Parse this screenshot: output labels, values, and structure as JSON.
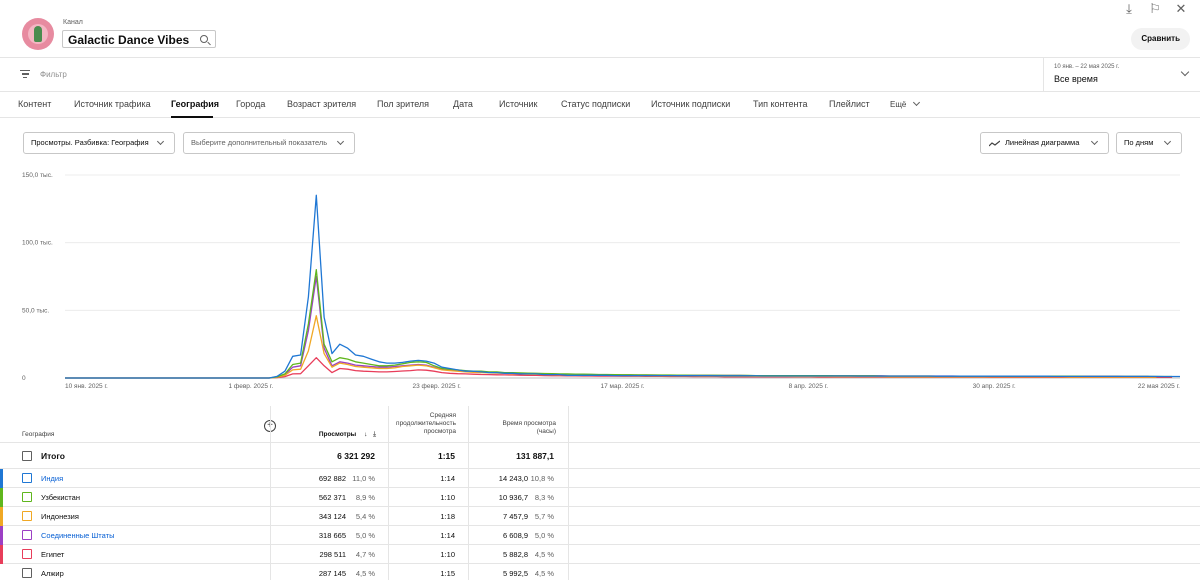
{
  "header": {
    "channel_label": "Канал",
    "channel_name": "Galactic Dance Vibes",
    "compare_label": "Сравнить",
    "icons": [
      "download-icon",
      "feedback-icon",
      "close-icon"
    ]
  },
  "filter": {
    "placeholder": "Фильтр",
    "date_range": "10 янв. – 22 мая 2025 г.",
    "date_value": "Все время"
  },
  "tabs": [
    {
      "label": "Контент"
    },
    {
      "label": "Источник трафика"
    },
    {
      "label": "География",
      "active": true
    },
    {
      "label": "Города"
    },
    {
      "label": "Возраст зрителя"
    },
    {
      "label": "Пол зрителя"
    },
    {
      "label": "Дата"
    },
    {
      "label": "Источник"
    },
    {
      "label": "Статус подписки"
    },
    {
      "label": "Источник подписки"
    },
    {
      "label": "Тип контента"
    },
    {
      "label": "Плейлист"
    },
    {
      "label": "Ещё"
    }
  ],
  "controls": {
    "metric": "Просмотры. Разбивка: География",
    "extra_metric": "Выберите дополнительный показатель",
    "chart_type": "Линейная диаграмма",
    "granularity": "По дням"
  },
  "chart_data": {
    "type": "line",
    "y_ticks": [
      "150,0 тыс.",
      "100,0 тыс.",
      "50,0 тыс.",
      "0"
    ],
    "ylim": [
      0,
      150000
    ],
    "x_ticks": [
      "10 янв. 2025 г.",
      "1 февр. 2025 г.",
      "23 февр. 2025 г.",
      "17 мар. 2025 г.",
      "8 апр. 2025 г.",
      "30 апр. 2025 г.",
      "22 мая 2025 г."
    ],
    "grid": true,
    "series": [
      {
        "name": "Индия",
        "color": "#1f77d4",
        "values": [
          0,
          0,
          0,
          0,
          0,
          0,
          0,
          0,
          0,
          0,
          0,
          0,
          0,
          0,
          0,
          0,
          0,
          0,
          0,
          0,
          0,
          0,
          0,
          0,
          0,
          0,
          0,
          1200,
          5000,
          16000,
          17000,
          60000,
          135000,
          45000,
          18000,
          25000,
          22000,
          17000,
          16000,
          14000,
          12000,
          11000,
          11000,
          11500,
          12500,
          13000,
          12500,
          11000,
          8000,
          7000,
          6000,
          5000,
          5000,
          4500,
          4000,
          4000,
          3500,
          3500,
          3000,
          3000,
          3000,
          2500,
          2500,
          2500,
          2000,
          2000,
          2000,
          2000,
          2000,
          2000,
          1800,
          1800,
          1800,
          1800,
          1800,
          1800,
          1800,
          1800,
          1700,
          1700,
          1700,
          1700,
          1700,
          1600,
          1600,
          1600,
          1600,
          1600,
          1600,
          1500,
          1500,
          1500,
          1500,
          1500,
          1500,
          1500,
          1500,
          1500,
          1500,
          1500,
          1500,
          1400,
          1400,
          1400,
          1400,
          1400,
          1400,
          1400,
          1400,
          1400,
          1400,
          1300,
          1300,
          1300,
          1300,
          1300,
          1300,
          1300,
          1300,
          1300,
          1300,
          1300,
          1300,
          1300,
          1300,
          1300,
          1200,
          1200,
          1200,
          1200,
          1200,
          1200,
          1200,
          1200,
          1200,
          1200,
          1200,
          1200,
          1200,
          1200,
          1100,
          1100,
          1100
        ]
      },
      {
        "name": "Узбекистан",
        "color": "#5fb61d",
        "values": [
          0,
          0,
          0,
          0,
          0,
          0,
          0,
          0,
          0,
          0,
          0,
          0,
          0,
          0,
          0,
          0,
          0,
          0,
          0,
          0,
          0,
          0,
          0,
          0,
          0,
          0,
          0,
          800,
          3000,
          10000,
          11000,
          40000,
          80000,
          25000,
          12000,
          15000,
          14000,
          12000,
          11000,
          10000,
          9000,
          9000,
          9500,
          10500,
          11500,
          12000,
          11500,
          9000,
          7000,
          6500,
          6000,
          5500,
          5000,
          5000,
          4500,
          4500,
          4000,
          4000,
          3800,
          3600,
          3500,
          3300,
          3200,
          3000,
          3000,
          2800,
          2800,
          2700,
          2600,
          2600,
          2500,
          2400,
          2400,
          2300,
          2300,
          2200,
          2200,
          2200,
          2100,
          2100,
          2000,
          2000,
          2000,
          2000,
          1900,
          1900,
          1900,
          1900,
          1800,
          1800,
          1800,
          1800,
          1800,
          1700,
          1700,
          1700,
          1700,
          1700,
          1600,
          1600,
          1600,
          1600,
          1600,
          1600,
          1500,
          1500,
          1500,
          1500,
          1500,
          1500,
          1500,
          1400,
          1400,
          1400,
          1400,
          1400,
          1400,
          1400,
          1400,
          1400,
          1300,
          1300,
          1300,
          1300,
          1300,
          1300,
          1300,
          1300,
          1300,
          1300,
          1200,
          1200,
          1200,
          1200,
          1200,
          1200,
          1200,
          1200,
          1200,
          1100,
          1100,
          1100
        ]
      },
      {
        "name": "Индонезия",
        "color": "#f0a824",
        "values": [
          0,
          0,
          0,
          0,
          0,
          0,
          0,
          0,
          0,
          0,
          0,
          0,
          0,
          0,
          0,
          0,
          0,
          0,
          0,
          0,
          0,
          0,
          0,
          0,
          0,
          0,
          0,
          500,
          2000,
          6000,
          6500,
          20000,
          46000,
          18000,
          8000,
          11000,
          10000,
          8500,
          8000,
          7500,
          7000,
          7000,
          7500,
          8500,
          9000,
          9500,
          9000,
          7500,
          6000,
          5500,
          5000,
          4500,
          4200,
          4000,
          3800,
          3600,
          3400,
          3200,
          3000,
          2800,
          2700,
          2600,
          2500,
          2400,
          2300,
          2200,
          2100,
          2000,
          2000,
          1900,
          1900,
          1800,
          1800,
          1700,
          1700,
          1600,
          1600,
          1600,
          1500,
          1500,
          1500,
          1400,
          1400,
          1400,
          1300,
          1300,
          1300,
          1300,
          1200,
          1200,
          1200,
          1200,
          1200,
          1100,
          1100,
          1100,
          1100,
          1100,
          1000,
          1000,
          1000,
          1000,
          1000,
          1000,
          1000,
          900,
          900,
          900,
          900,
          900,
          900,
          900,
          900,
          900,
          900,
          800,
          800,
          800,
          800,
          800,
          800,
          800,
          800,
          800,
          800,
          800,
          800,
          800,
          700,
          700,
          700,
          700,
          700,
          700,
          700,
          700,
          700,
          700,
          700,
          700
        ]
      },
      {
        "name": "Соединенные Штаты",
        "color": "#9c3fc4",
        "values": [
          0,
          0,
          0,
          0,
          0,
          0,
          0,
          0,
          0,
          0,
          0,
          0,
          0,
          0,
          0,
          0,
          0,
          0,
          0,
          0,
          0,
          0,
          0,
          0,
          0,
          0,
          0,
          600,
          2500,
          8000,
          9000,
          35000,
          75000,
          22000,
          9000,
          12000,
          11000,
          9500,
          9000,
          8500,
          8000,
          8000,
          8500,
          9000,
          9500,
          10000,
          9500,
          8000,
          6500,
          6000,
          5500,
          5000,
          4800,
          4500,
          4200,
          4000,
          3800,
          3600,
          3400,
          3300,
          3200,
          3100,
          3000,
          2900,
          2800,
          2700,
          2600,
          2500,
          2500,
          2400,
          2400,
          2300,
          2300,
          2200,
          2200,
          2200,
          2100,
          2100,
          2100,
          2000,
          2000,
          2000,
          2000,
          1900,
          1900,
          1900,
          1900,
          1800,
          1800,
          1800,
          1800,
          1800,
          1700,
          1700,
          1700,
          1700,
          1700,
          1700,
          1600,
          1600,
          1600,
          1600,
          1600,
          1600,
          1600,
          1500,
          1500,
          1500,
          1500,
          1500,
          1500,
          1500,
          1500,
          1500,
          1400,
          1400,
          1400,
          1400,
          1400,
          1400,
          1400,
          1400,
          1400,
          1400,
          1300,
          1300,
          1300,
          1300,
          1300,
          1300,
          1300,
          1300,
          1300,
          1300,
          1300,
          1200,
          1200,
          1200,
          1200
        ]
      },
      {
        "name": "Египет",
        "color": "#e83d5a",
        "values": [
          0,
          0,
          0,
          0,
          0,
          0,
          0,
          0,
          0,
          0,
          0,
          0,
          0,
          0,
          0,
          0,
          0,
          0,
          0,
          0,
          0,
          0,
          0,
          0,
          0,
          0,
          0,
          300,
          1000,
          3000,
          3200,
          9000,
          15000,
          9000,
          4000,
          7000,
          6500,
          5500,
          5000,
          4800,
          4500,
          4500,
          4800,
          5200,
          5500,
          6000,
          5800,
          5000,
          4000,
          3500,
          3200,
          3000,
          2800,
          2600,
          2500,
          2400,
          2300,
          2200,
          2100,
          2000,
          1900,
          1800,
          1700,
          1700,
          1600,
          1600,
          1500,
          1500,
          1400,
          1400,
          1400,
          1300,
          1300,
          1300,
          1200,
          1200,
          1200,
          1100,
          1100,
          1100,
          1000,
          1000,
          1000,
          1000,
          900,
          900,
          900,
          900,
          900,
          800,
          800,
          800,
          800,
          800,
          800,
          800,
          700,
          700,
          700,
          700,
          700,
          700,
          700,
          700,
          700,
          600,
          600,
          600,
          600,
          600,
          600,
          600,
          600,
          600,
          600,
          600,
          600,
          600,
          500,
          500,
          500,
          500,
          500,
          500,
          500,
          500,
          500,
          500,
          500,
          500,
          500,
          500,
          500,
          500,
          500,
          500,
          500,
          500,
          500,
          500,
          500,
          500
        ]
      }
    ]
  },
  "table": {
    "headers": {
      "geo": "География",
      "views": "Просмотры",
      "avg_duration": "Средняя продолжительность просмотра",
      "watch_time": "Время просмотра (часы)"
    },
    "total": {
      "label": "Итого",
      "views": "6 321 292",
      "avg": "1:15",
      "watch": "131 887,1"
    },
    "rows": [
      {
        "name": "Индия",
        "color": "#1f77d4",
        "link": true,
        "views": "692 882",
        "views_pct": "11,0 %",
        "avg": "1:14",
        "watch": "14 243,0",
        "watch_pct": "10,8 %"
      },
      {
        "name": "Узбекистан",
        "color": "#5fb61d",
        "link": false,
        "views": "562 371",
        "views_pct": "8,9 %",
        "avg": "1:10",
        "watch": "10 936,7",
        "watch_pct": "8,3 %"
      },
      {
        "name": "Индонезия",
        "color": "#f0a824",
        "link": false,
        "views": "343 124",
        "views_pct": "5,4 %",
        "avg": "1:18",
        "watch": "7 457,9",
        "watch_pct": "5,7 %"
      },
      {
        "name": "Соединенные Штаты",
        "color": "#9c3fc4",
        "link": true,
        "views": "318 665",
        "views_pct": "5,0 %",
        "avg": "1:14",
        "watch": "6 608,9",
        "watch_pct": "5,0 %"
      },
      {
        "name": "Египет",
        "color": "#e83d5a",
        "link": false,
        "views": "298 511",
        "views_pct": "4,7 %",
        "avg": "1:10",
        "watch": "5 882,8",
        "watch_pct": "4,5 %"
      },
      {
        "name": "Алжир",
        "color": "",
        "link": false,
        "views": "287 145",
        "views_pct": "4,5 %",
        "avg": "1:15",
        "watch": "5 992,5",
        "watch_pct": "4,5 %"
      }
    ]
  }
}
